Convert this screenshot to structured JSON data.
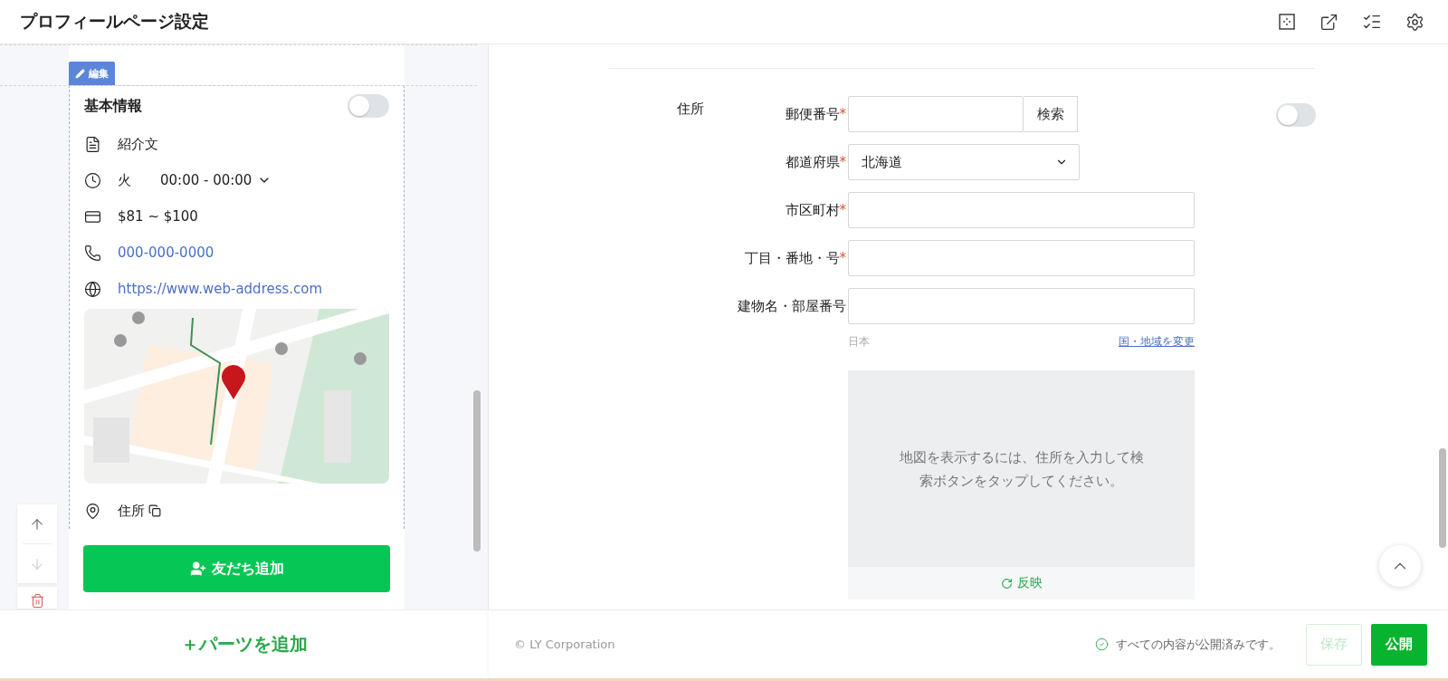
{
  "header": {
    "title": "プロフィールページ設定"
  },
  "editor": {
    "edit_tab": "編集",
    "move_down_disabled": true,
    "card": {
      "title": "基本情報",
      "toggle_on": false,
      "items": [
        {
          "kind": "intro",
          "label": "紹介文"
        },
        {
          "kind": "hours",
          "day": "火",
          "time": "00:00 - 00:00"
        },
        {
          "kind": "price",
          "label": "$81 ~ $100"
        },
        {
          "kind": "phone",
          "label": "000-000-0000"
        },
        {
          "kind": "web",
          "label": "https://www.web-address.com"
        },
        {
          "kind": "map"
        },
        {
          "kind": "address",
          "label": "住所"
        }
      ],
      "button": "友だち追加"
    },
    "add_parts": "＋パーツを追加"
  },
  "form": {
    "section_label": "住所",
    "toggle_on": false,
    "fields": [
      {
        "kind": "postal",
        "label": "郵便番号",
        "required_mark": "*",
        "button": "検索"
      },
      {
        "kind": "select",
        "label": "都道府県",
        "required_mark": "*",
        "value": "北海道"
      },
      {
        "kind": "text",
        "label": "市区町村",
        "required_mark": "*"
      },
      {
        "kind": "text",
        "label": "丁目・番地・号",
        "required_mark": "*"
      },
      {
        "kind": "text",
        "label": "建物名・部屋番号"
      }
    ],
    "country": "日本",
    "change_country_link": "国・地域を変更",
    "map_hint": "地図を表示するには、住所を入力して検索ボタンをタップしてください。",
    "reflect_button": "反映"
  },
  "footer": {
    "copyright": "© LY Corporation",
    "status": "すべての内容が公開済みです。",
    "save": {
      "label": "保存",
      "disabled": true
    },
    "publish": "公開"
  }
}
